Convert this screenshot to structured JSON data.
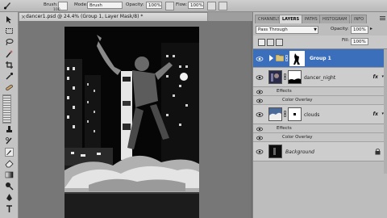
{
  "options_bar": {
    "brush_label": "Brush:",
    "brush_size": "100",
    "mode_label": "Mode:",
    "mode_value": "Brush",
    "opacity_label": "Opacity:",
    "opacity_value": "100%",
    "flow_label": "Flow:",
    "flow_value": "100%"
  },
  "document": {
    "tab_title": "dancer1.psd @ 24.4% (Group 1, Layer Mask/8) *",
    "close_glyph": "×"
  },
  "panel": {
    "tabs": [
      "CHANNELS",
      "LAYERS",
      "PATHS",
      "HISTOGRAM",
      "INFO"
    ],
    "active_tab": "LAYERS",
    "blend_mode": "Pass Through",
    "opacity_label": "Opacity:",
    "opacity_value": "100%",
    "fill_label": "Fill:",
    "fill_value": "100%",
    "layers": [
      {
        "name": "Group 1",
        "selected": true
      },
      {
        "name": "dancer_night",
        "fx": "fx",
        "effects_label": "Effects",
        "effect": "Color Overlay"
      },
      {
        "name": "clouds",
        "fx": "fx",
        "effects_label": "Effects",
        "effect": "Color Overlay"
      },
      {
        "name": "Background",
        "locked": true
      }
    ]
  },
  "icons": [
    "brush-icon",
    "move-icon",
    "marquee-icon",
    "lasso-icon",
    "magic-wand-icon",
    "crop-icon",
    "eyedropper-icon",
    "healing-icon",
    "eraser-icon",
    "gradient-icon",
    "dodge-icon",
    "pen-icon",
    "type-icon",
    "path-select-icon",
    "eye-icon",
    "folder-icon",
    "lock-icon"
  ]
}
